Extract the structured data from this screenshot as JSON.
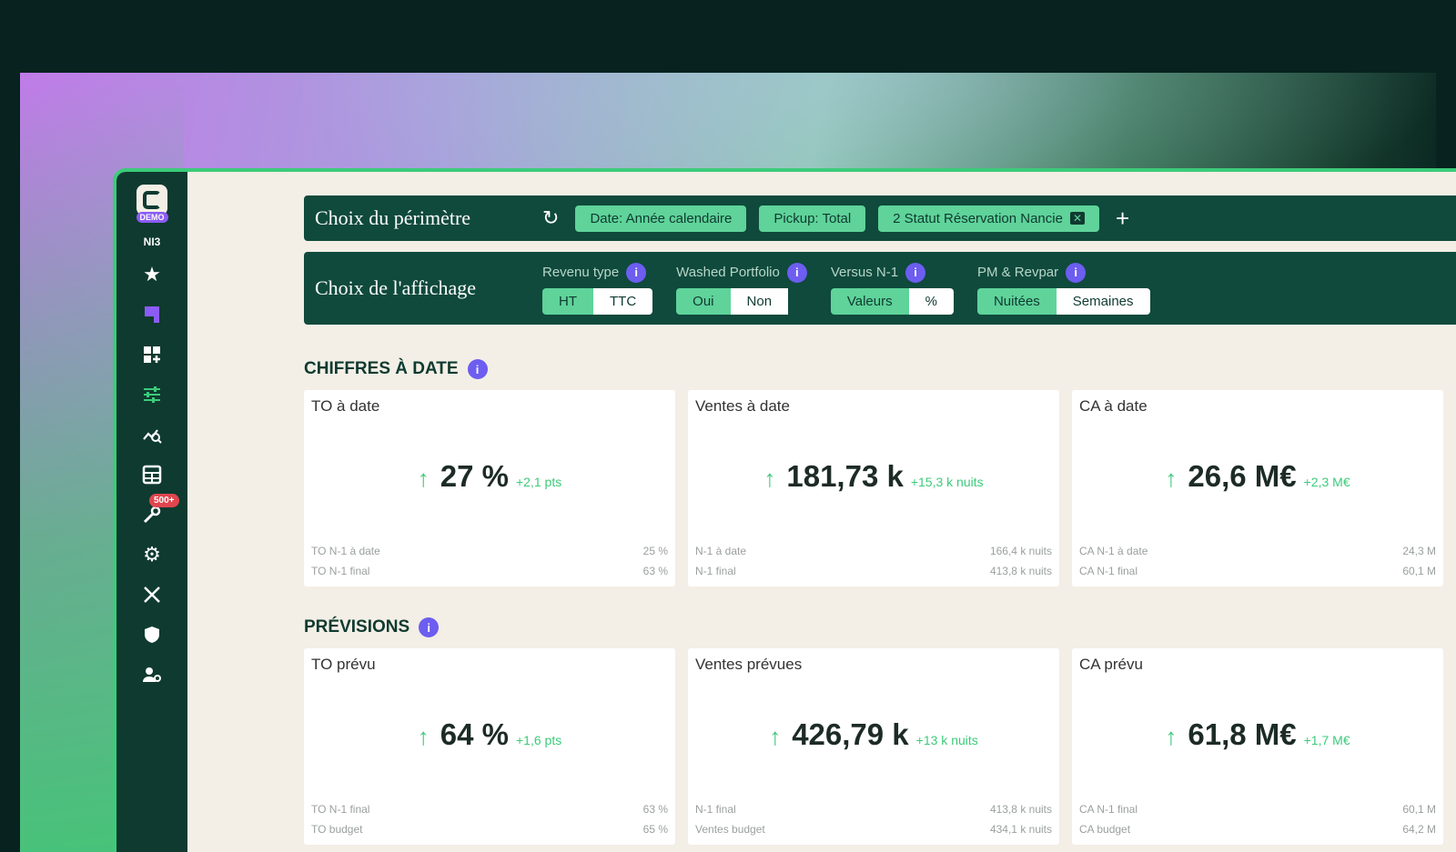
{
  "sidebar": {
    "demo_badge": "DEMO",
    "user_label": "NI3",
    "notif_count": "500+"
  },
  "perimetre": {
    "title": "Choix du périmètre",
    "chips": [
      "Date: Année calendaire",
      "Pickup: Total",
      "2 Statut Réservation Nancie"
    ]
  },
  "affichage": {
    "title": "Choix de l'affichage",
    "options": [
      {
        "label": "Revenu type",
        "choices": [
          "HT",
          "TTC"
        ],
        "selected": "HT"
      },
      {
        "label": "Washed Portfolio",
        "choices": [
          "Oui",
          "Non"
        ],
        "selected": "Oui"
      },
      {
        "label": "Versus N-1",
        "choices": [
          "Valeurs",
          "%"
        ],
        "selected": "Valeurs"
      },
      {
        "label": "PM & Revpar",
        "choices": [
          "Nuitées",
          "Semaines"
        ],
        "selected": "Nuitées"
      }
    ]
  },
  "chiffres": {
    "title": "CHIFFRES À DATE",
    "cards": [
      {
        "title": "TO à date",
        "value": "27 %",
        "delta": "+2,1 pts",
        "rows": [
          {
            "label": "TO N-1 à date",
            "value": "25 %"
          },
          {
            "label": "TO N-1 final",
            "value": "63 %"
          }
        ]
      },
      {
        "title": "Ventes à date",
        "value": "181,73 k",
        "delta": "+15,3 k nuits",
        "rows": [
          {
            "label": "N-1 à date",
            "value": "166,4 k nuits"
          },
          {
            "label": "N-1 final",
            "value": "413,8 k nuits"
          }
        ]
      },
      {
        "title": "CA à date",
        "value": "26,6 M€",
        "delta": "+2,3 M€",
        "rows": [
          {
            "label": "CA N-1 à date",
            "value": "24,3 M"
          },
          {
            "label": "CA N-1 final",
            "value": "60,1 M"
          }
        ]
      }
    ]
  },
  "previsions": {
    "title": "PRÉVISIONS",
    "cards": [
      {
        "title": "TO prévu",
        "value": "64 %",
        "delta": "+1,6 pts",
        "rows": [
          {
            "label": "TO N-1 final",
            "value": "63 %"
          },
          {
            "label": "TO budget",
            "value": "65 %"
          }
        ]
      },
      {
        "title": "Ventes prévues",
        "value": "426,79 k",
        "delta": "+13 k nuits",
        "rows": [
          {
            "label": "N-1 final",
            "value": "413,8 k nuits"
          },
          {
            "label": "Ventes budget",
            "value": "434,1 k nuits"
          }
        ]
      },
      {
        "title": "CA prévu",
        "value": "61,8 M€",
        "delta": "+1,7 M€",
        "rows": [
          {
            "label": "CA N-1 final",
            "value": "60,1 M"
          },
          {
            "label": "CA budget",
            "value": "64,2 M"
          }
        ]
      }
    ]
  }
}
